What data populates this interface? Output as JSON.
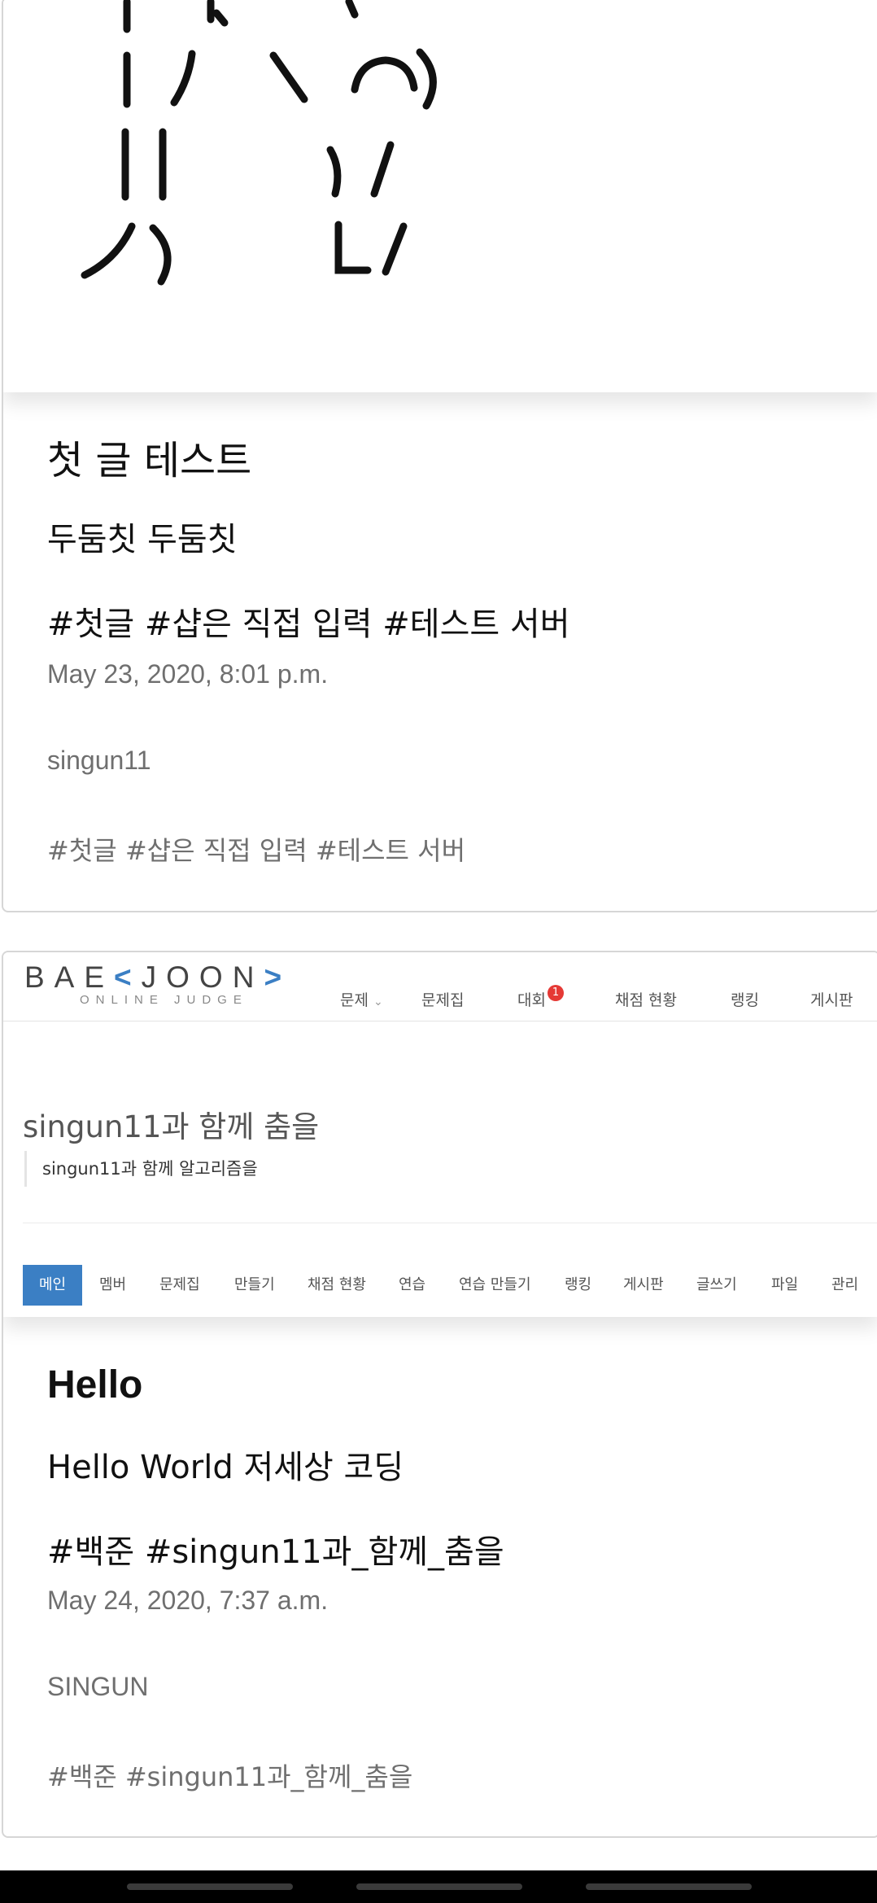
{
  "posts": [
    {
      "title": "첫 글 테스트",
      "body": "두둠칫 두둠칫",
      "tags": "#첫글 #샵은 직접 입력 #테스트 서버",
      "date": "May 23, 2020, 8:01 p.m.",
      "author": "singun11",
      "tags_small": "#첫글 #샵은 직접 입력 #테스트 서버"
    },
    {
      "title": "Hello",
      "body": "Hello World 저세상 코딩",
      "tags": "#백준 #singun11과_함께_춤을",
      "date": "May 24, 2020, 7:37 a.m.",
      "author": "SINGUN",
      "tags_small": "#백준 #singun11과_함께_춤을"
    }
  ],
  "boj": {
    "logo_word_1": "BAE",
    "logo_bracket_open": "<",
    "logo_word_2": "JOON",
    "logo_bracket_close": ">",
    "logo_sub": "ONLINE JUDGE",
    "nav": [
      "문제",
      "문제집",
      "대회",
      "채점 현황",
      "랭킹",
      "게시판"
    ],
    "nav_dropdown_glyph": "⌄",
    "contest_badge": "1",
    "group_title": "singun11과 함께 춤을",
    "group_desc": "singun11과 함께 알고리즘을",
    "subnav": [
      "메인",
      "멤버",
      "문제집",
      "만들기",
      "채점 현황",
      "연습",
      "연습 만들기",
      "랭킹",
      "게시판",
      "글쓰기",
      "파일",
      "관리"
    ],
    "accent": "#3b7fc4"
  }
}
